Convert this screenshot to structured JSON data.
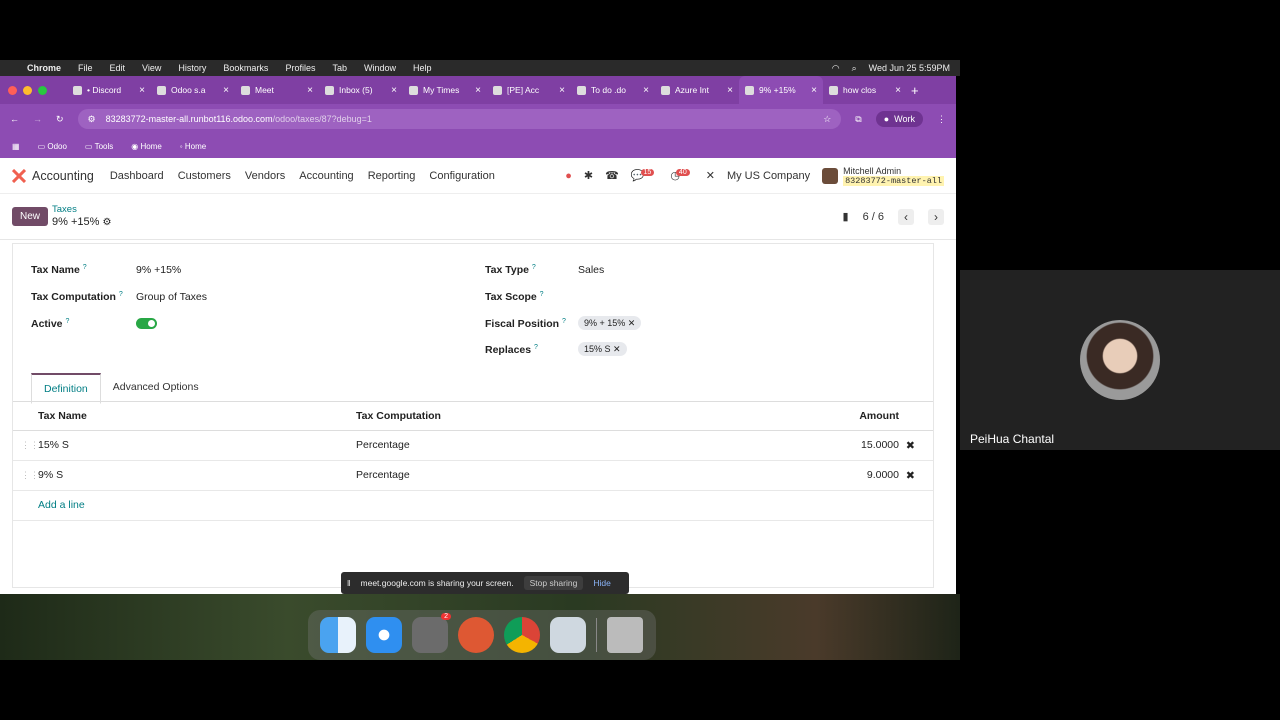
{
  "macbar": {
    "app": "Chrome",
    "menus": [
      "File",
      "Edit",
      "View",
      "History",
      "Bookmarks",
      "Profiles",
      "Tab",
      "Window",
      "Help"
    ],
    "clock": "Wed Jun 25  5:59PM"
  },
  "tabs": [
    {
      "title": "• Discord"
    },
    {
      "title": "Odoo s.a"
    },
    {
      "title": "Meet"
    },
    {
      "title": "Inbox (5)"
    },
    {
      "title": "My Times"
    },
    {
      "title": "[PE] Acc"
    },
    {
      "title": "To do .do"
    },
    {
      "title": "Azure Int"
    },
    {
      "title": "9% +15%"
    },
    {
      "title": "how clos"
    }
  ],
  "address": {
    "host": "83283772-master-all.runbot116.odoo.com",
    "path": "/odoo/taxes/87?debug=1",
    "profile": "Work"
  },
  "bookmarks": [
    "Odoo",
    "Tools",
    "Home",
    "Home"
  ],
  "nav": {
    "app": "Accounting",
    "menu": [
      "Dashboard",
      "Customers",
      "Vendors",
      "Accounting",
      "Reporting",
      "Configuration"
    ],
    "chat_count": "15",
    "activity_count": "40",
    "company": "My US Company",
    "user": "Mitchell Admin",
    "db": "83283772-master-all"
  },
  "cp": {
    "new": "New",
    "crumb": "Taxes",
    "record": "9% +15%",
    "pager": "6 / 6"
  },
  "form": {
    "tax_name_label": "Tax Name",
    "tax_name": "9% +15%",
    "tax_comp_label": "Tax Computation",
    "tax_comp": "Group of Taxes",
    "active_label": "Active",
    "tax_type_label": "Tax Type",
    "tax_type": "Sales",
    "tax_scope_label": "Tax Scope",
    "fiscal_label": "Fiscal Position",
    "fiscal_tag": "9% + 15%",
    "replaces_label": "Replaces",
    "replaces_tag": "15% S",
    "q": "?"
  },
  "notebook": {
    "tab1": "Definition",
    "tab2": "Advanced Options"
  },
  "lines": {
    "h_name": "Tax Name",
    "h_comp": "Tax Computation",
    "h_amount": "Amount",
    "rows": [
      {
        "name": "15% S",
        "comp": "Percentage",
        "amount": "15.0000"
      },
      {
        "name": "9% S",
        "comp": "Percentage",
        "amount": "9.0000"
      }
    ],
    "add": "Add a line"
  },
  "share": {
    "text": "meet.google.com is sharing your screen.",
    "stop": "Stop sharing",
    "hide": "Hide"
  },
  "video": {
    "name": "PeiHua Chantal"
  },
  "dock_badge": "2",
  "colors": {
    "brand": "#714b67",
    "teal": "#017e84",
    "chrome_purple": "#8d4cb3"
  }
}
